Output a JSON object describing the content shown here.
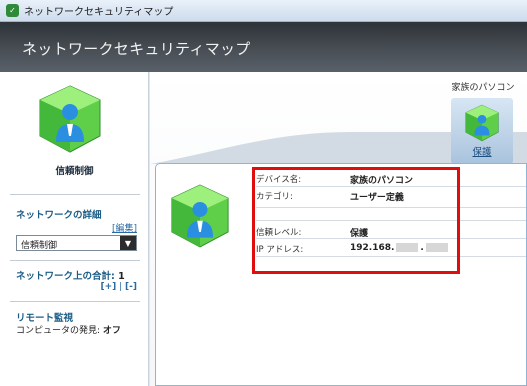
{
  "window": {
    "title": "ネットワークセキュリティマップ"
  },
  "header": {
    "title": "ネットワークセキュリティマップ"
  },
  "left": {
    "trust_caption": "信頼制御",
    "network_details_title": "ネットワークの詳細",
    "edit_link": "[編集]",
    "trust_dropdown_value": "信頼制御",
    "total_label": "ネットワーク上の合計:",
    "total_count": "1",
    "zoom_in": "[+]",
    "zoom_sep": "|",
    "zoom_out": "[-]",
    "remote_title": "リモート監視",
    "discovery_label": "コンピュータの発見:",
    "discovery_value": "オフ"
  },
  "map": {
    "node_label": "家族のパソコン",
    "node_status": "保護"
  },
  "details": {
    "device_name_key": "デバイス名:",
    "device_name_val": "家族のパソコン",
    "category_key": "カテゴリ:",
    "category_val": "ユーザー定義",
    "trust_level_key": "信頼レベル:",
    "trust_level_val": "保護",
    "ip_key": "IP アドレス:",
    "ip_val_prefix": "192.168.",
    "ip_val_dot": "."
  },
  "colors": {
    "highlight": "#e00d0d",
    "accent": "#1a5c86",
    "cube_green": "#3bb53b",
    "person_blue": "#2a8fe0"
  },
  "icons": [
    "app-icon",
    "secure-computer-cube-icon",
    "dropdown-arrow-icon"
  ]
}
